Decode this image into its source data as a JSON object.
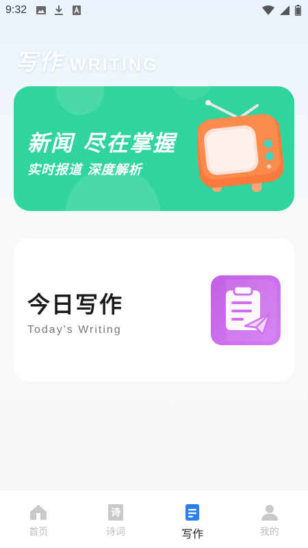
{
  "status_bar": {
    "time": "9:32",
    "icons": [
      "image-icon",
      "download-icon",
      "font-a-icon",
      "wifi-icon",
      "signal-icon",
      "battery-icon"
    ]
  },
  "header": {
    "title_cn": "写作",
    "title_en": "WRITING"
  },
  "banner": {
    "title": "新闻 尽在掌握",
    "subtitle": "实时报道 深度解析",
    "illustration": "tv-icon",
    "colors": {
      "background": "#2fd59c",
      "tv": "#f97a3c"
    }
  },
  "today_card": {
    "title": "今日写作",
    "subtitle": "Today's Writing",
    "icon": "clipboard-send-icon",
    "icon_color": "#c868ea"
  },
  "bottom_nav": {
    "items": [
      {
        "label": "首页",
        "icon": "home-icon",
        "active": false
      },
      {
        "label": "诗词",
        "icon": "poem-icon",
        "active": false
      },
      {
        "label": "写作",
        "icon": "document-icon",
        "active": true
      },
      {
        "label": "我的",
        "icon": "user-icon",
        "active": false
      }
    ],
    "active_color": "#2a80f0",
    "inactive_color": "#bdbdbd"
  }
}
